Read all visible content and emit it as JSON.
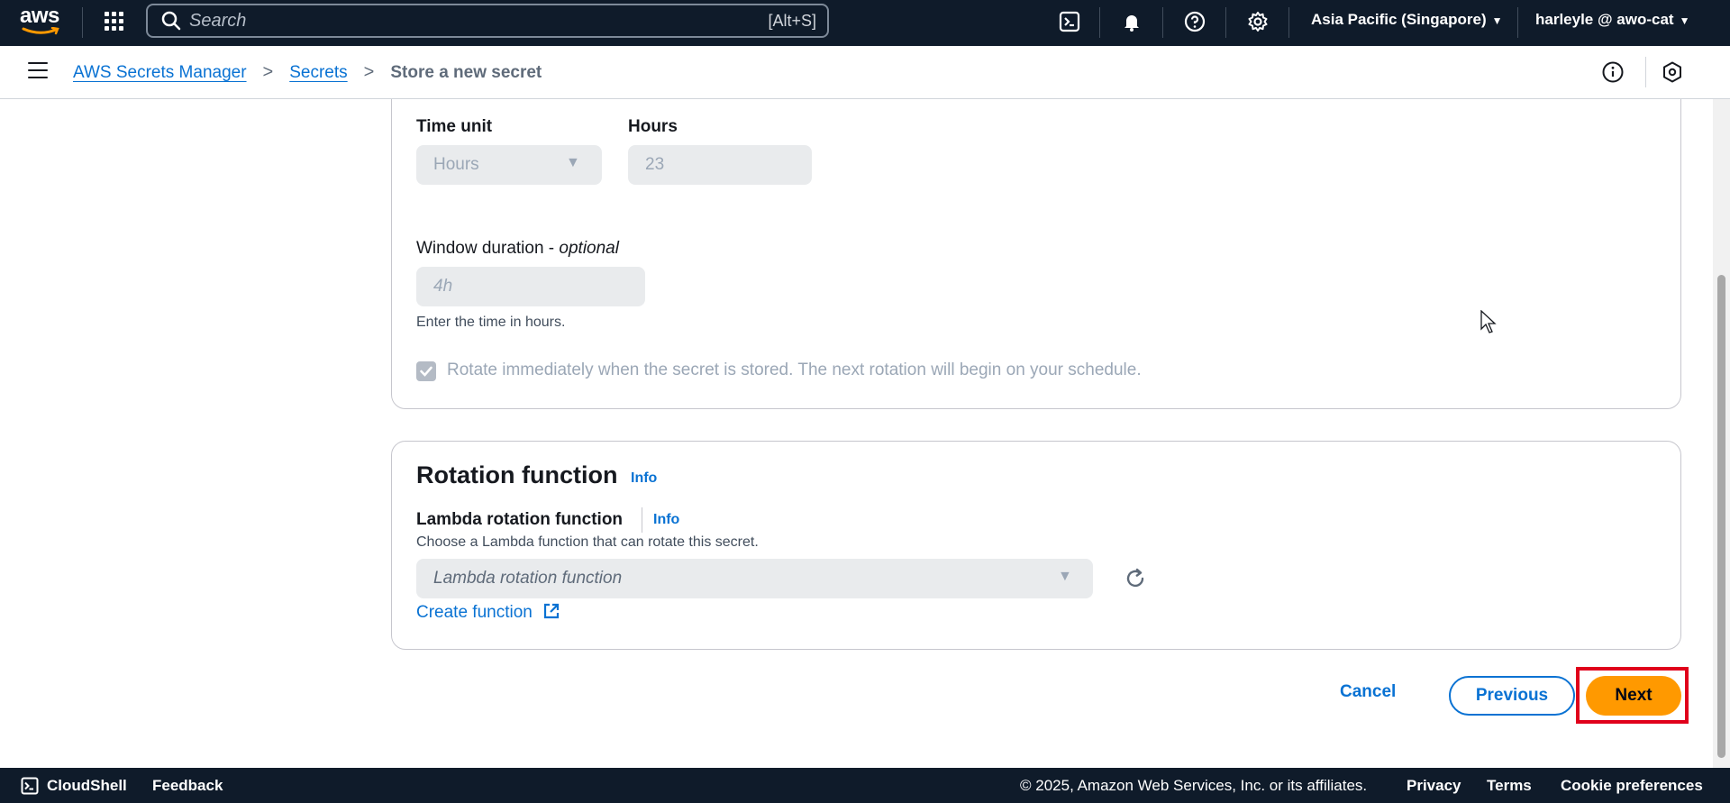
{
  "topnav": {
    "logo_text": "aws",
    "search_placeholder": "Search",
    "search_shortcut": "[Alt+S]",
    "region": "Asia Pacific (Singapore)",
    "user": "harleyle @ awo-cat"
  },
  "breadcrumb": {
    "items": [
      "AWS Secrets Manager",
      "Secrets"
    ],
    "current": "Store a new secret"
  },
  "schedule": {
    "time_unit_label": "Time unit",
    "time_unit_value": "Hours",
    "hours_label": "Hours",
    "hours_value": "23",
    "window_label": "Window duration - ",
    "window_optional": "optional",
    "window_placeholder": "4h",
    "window_hint": "Enter the time in hours.",
    "rotate_immediately_label": "Rotate immediately when the secret is stored. The next rotation will begin on your schedule."
  },
  "rotation_function": {
    "title": "Rotation function",
    "title_info": "Info",
    "lambda_label": "Lambda rotation function",
    "lambda_info": "Info",
    "lambda_description": "Choose a Lambda function that can rotate this secret.",
    "lambda_placeholder": "Lambda rotation function",
    "create_function": "Create function"
  },
  "actions": {
    "cancel": "Cancel",
    "previous": "Previous",
    "next": "Next"
  },
  "footer": {
    "cloudshell": "CloudShell",
    "feedback": "Feedback",
    "copyright": "© 2025, Amazon Web Services, Inc. or its affiliates.",
    "privacy": "Privacy",
    "terms": "Terms",
    "cookie": "Cookie preferences"
  },
  "colors": {
    "nav_bg": "#0f1b2a",
    "link": "#0972d3",
    "primary_button": "#ff9900",
    "highlight": "#e0001b"
  }
}
